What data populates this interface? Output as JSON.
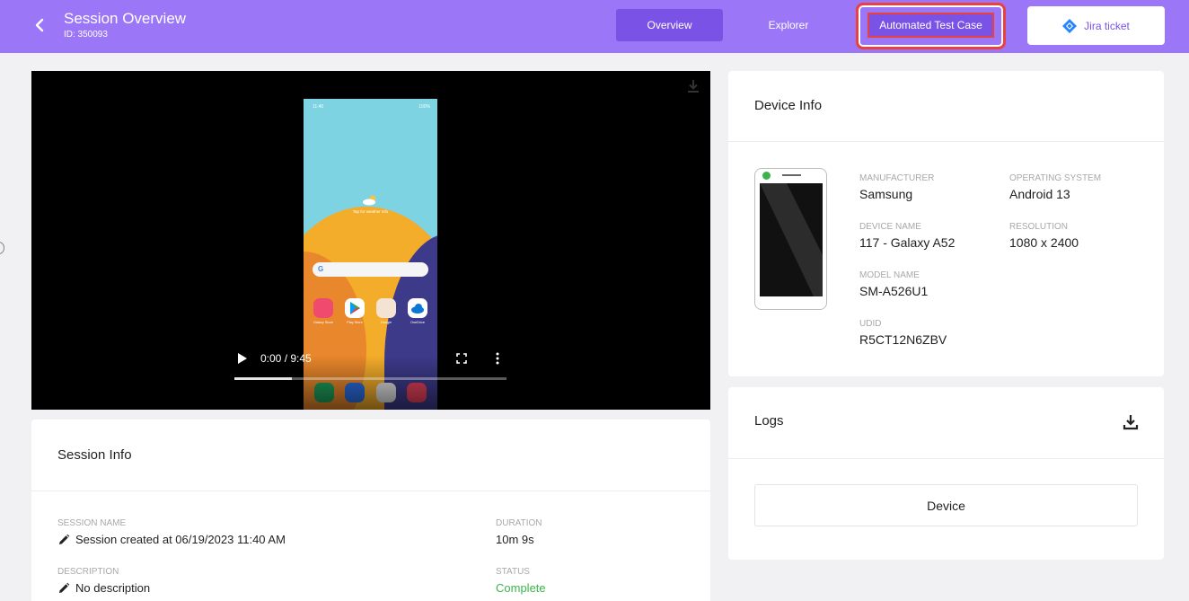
{
  "header": {
    "title": "Session Overview",
    "session_id": "ID: 350093",
    "tabs": [
      "Overview",
      "Explorer",
      "Automated Test Case"
    ],
    "jira_label": "Jira ticket"
  },
  "video": {
    "time": "0:00 / 9:45",
    "progress": 0.21,
    "phone_status_time": "11:40",
    "phone_status_battery": "100%",
    "weather_text": "Tap for weather info",
    "apps": [
      "Galaxy Store",
      "Play Store",
      "Google",
      "OneDrive"
    ]
  },
  "session_info": {
    "title": "Session Info",
    "session_name_label": "SESSION NAME",
    "session_name": "Session created at 06/19/2023 11:40 AM",
    "duration_label": "DURATION",
    "duration": "10m 9s",
    "description_label": "DESCRIPTION",
    "description": "No description",
    "status_label": "STATUS",
    "status": "Complete"
  },
  "device_info": {
    "title": "Device Info",
    "manufacturer_label": "MANUFACTURER",
    "manufacturer": "Samsung",
    "os_label": "OPERATING SYSTEM",
    "os": "Android 13",
    "device_name_label": "DEVICE NAME",
    "device_name": "117 - Galaxy A52",
    "resolution_label": "RESOLUTION",
    "resolution": "1080 x 2400",
    "model_label": "MODEL NAME",
    "model": "SM-A526U1",
    "udid_label": "UDID",
    "udid": "R5CT12N6ZBV"
  },
  "logs": {
    "title": "Logs",
    "device_button": "Device"
  },
  "colors": {
    "header": "#9b76f7",
    "active_tab": "#7a52e6",
    "highlight": "#e8413f",
    "status_complete": "#3bb54a"
  }
}
